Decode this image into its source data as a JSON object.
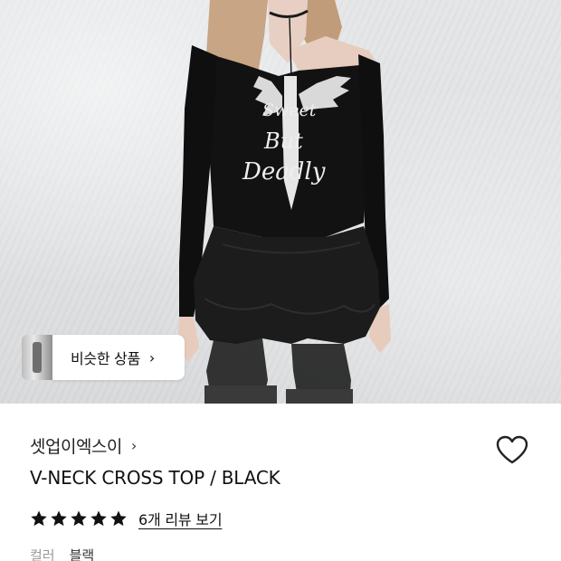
{
  "similar_products": {
    "label": "비슷한 상품",
    "chevron": "›",
    "thumb_icon": "product-thumbnail"
  },
  "product": {
    "brand": "셋업이엑스이",
    "brand_chevron": "›",
    "title": "V-NECK CROSS TOP / BLACK",
    "rating_stars": 5,
    "review_link": "6개 리뷰 보기",
    "option_label": "컬러",
    "option_value": "블랙",
    "print_lines": [
      "Sweet",
      "But",
      "Deadly"
    ]
  },
  "icons": {
    "wishlist": "heart-outline-icon",
    "star": "star-filled-icon",
    "chevron": "chevron-right-icon"
  },
  "colors": {
    "text": "#111111",
    "muted": "#9a9a9a",
    "star": "#111111",
    "background": "#ffffff"
  }
}
